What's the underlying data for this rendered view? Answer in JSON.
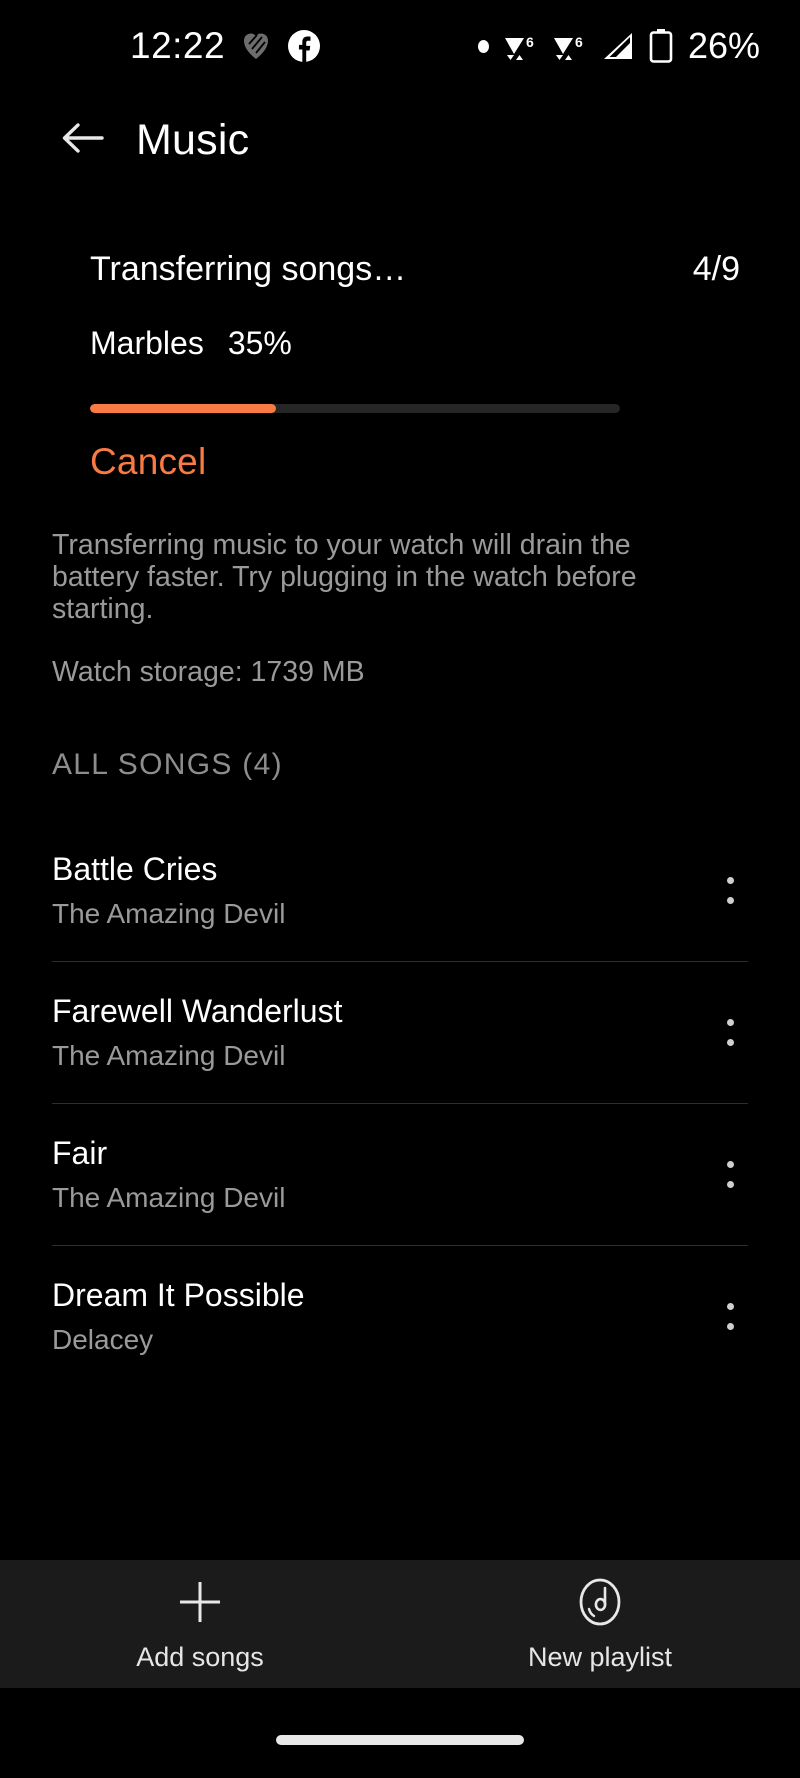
{
  "statusbar": {
    "time": "12:22",
    "battery_percent": "26%",
    "icons": [
      "heart-stripes-icon",
      "facebook-icon",
      "notification-dot-icon",
      "wifi-6-signal-icon",
      "wifi-6-signal-icon",
      "cellular-signal-icon",
      "battery-icon"
    ]
  },
  "appbar": {
    "back_icon": "arrow-left-icon",
    "title": "Music"
  },
  "transfer": {
    "status": "Transferring songs…",
    "count": "4/9",
    "track_name": "Marbles",
    "percent_label": "35%",
    "percent_value": 35,
    "cancel_label": "Cancel",
    "accent_color": "#F97B43",
    "track_bg_color": "#262626"
  },
  "description": {
    "body": "Transferring music to your watch will drain the battery faster. Try plugging in the watch before starting.",
    "storage": "Watch storage: 1739 MB"
  },
  "section": {
    "header": "ALL SONGS (4)"
  },
  "songs": [
    {
      "title": "Battle Cries",
      "artist": "The Amazing Devil",
      "menu_icon": "overflow-menu-icon"
    },
    {
      "title": "Farewell Wanderlust",
      "artist": "The Amazing Devil",
      "menu_icon": "overflow-menu-icon"
    },
    {
      "title": "Fair",
      "artist": "The Amazing Devil",
      "menu_icon": "overflow-menu-icon"
    },
    {
      "title": "Dream It Possible",
      "artist": "Delacey",
      "menu_icon": "overflow-menu-icon"
    }
  ],
  "bottombar": {
    "items": [
      {
        "label": "Add songs",
        "icon": "plus-icon"
      },
      {
        "label": "New playlist",
        "icon": "vinyl-note-icon"
      }
    ]
  }
}
